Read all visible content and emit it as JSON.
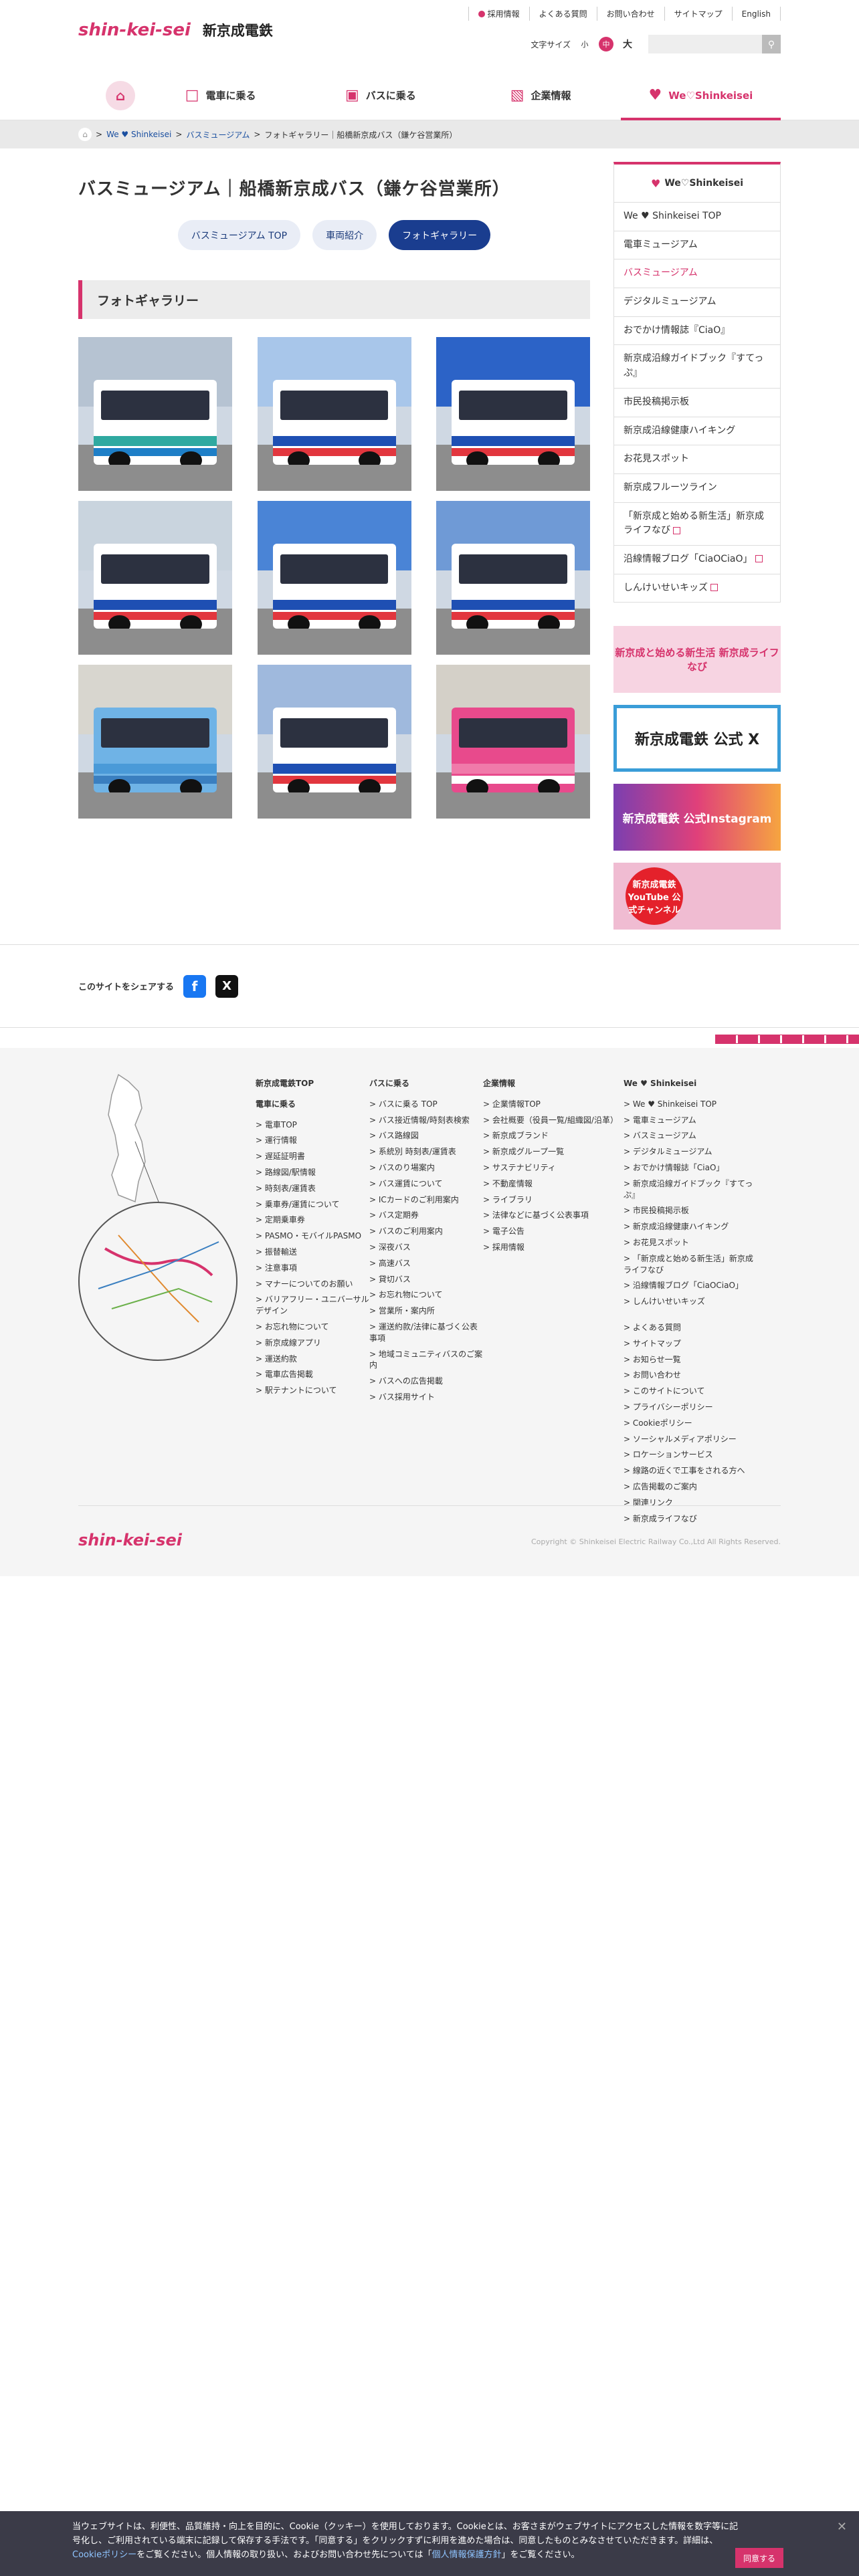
{
  "header": {
    "logo_mark": "shin-kei-sei",
    "logo_name": "新京成電鉄",
    "util_links": [
      "採用情報",
      "よくある質問",
      "お問い合わせ",
      "サイトマップ",
      "English"
    ],
    "font_size_label": "文字サイズ",
    "font_sizes": [
      "小",
      "中",
      "大"
    ],
    "search_placeholder": ""
  },
  "gnav": {
    "items": [
      {
        "label": "電車に乗る",
        "icon": "train-icon"
      },
      {
        "label": "バスに乗る",
        "icon": "bus-icon"
      },
      {
        "label": "企業情報",
        "icon": "building-icon"
      },
      {
        "label": "We♡Shinkeisei",
        "icon": "heart-icon"
      }
    ]
  },
  "breadcrumb": [
    "We ♥ Shinkeisei",
    "バスミュージアム",
    "フォトギャラリー｜船橋新京成バス（鎌ケ谷営業所）"
  ],
  "page": {
    "title": "バスミュージアム｜船橋新京成バス（鎌ケ谷営業所）",
    "tabs": [
      "バスミュージアム TOP",
      "車両紹介",
      "フォトギャラリー"
    ],
    "section_title": "フォトギャラリー",
    "photos": [
      {
        "body": "#ffffff",
        "stripe": "#2fa9a0",
        "stripe2": "#1e7fc7",
        "sky": "#b6c3d2"
      },
      {
        "body": "#ffffff",
        "stripe": "#1e4fb3",
        "stripe2": "#e2363e",
        "sky": "#a8c6ea"
      },
      {
        "body": "#ffffff",
        "stripe": "#1e4fb3",
        "stripe2": "#e2363e",
        "sky": "#2c63c7"
      },
      {
        "body": "#ffffff",
        "stripe": "#1e4fb3",
        "stripe2": "#e2363e",
        "sky": "#c9d4de"
      },
      {
        "body": "#ffffff",
        "stripe": "#1e4fb3",
        "stripe2": "#e2363e",
        "sky": "#4a84d6"
      },
      {
        "body": "#ffffff",
        "stripe": "#1e4fb3",
        "stripe2": "#e2363e",
        "sky": "#6f9ad6"
      },
      {
        "body": "#6fb3e6",
        "stripe": "#4a9ad8",
        "stripe2": "#3a7fc0",
        "sky": "#d8d6cf"
      },
      {
        "body": "#ffffff",
        "stripe": "#1e4fb3",
        "stripe2": "#e2363e",
        "sky": "#9fb9dd"
      },
      {
        "body": "#e84a8c",
        "stripe": "#f07aaa",
        "stripe2": "#ffffff",
        "sky": "#d4d0c8"
      }
    ]
  },
  "sidebar": {
    "title": "We♡Shinkeisei",
    "items": [
      {
        "label": "We ♥ Shinkeisei TOP",
        "ext": false
      },
      {
        "label": "電車ミュージアム",
        "ext": false
      },
      {
        "label": "バスミュージアム",
        "ext": false,
        "current": true
      },
      {
        "label": "デジタルミュージアム",
        "ext": false
      },
      {
        "label": "おでかけ情報誌『CiaO』",
        "ext": false
      },
      {
        "label": "新京成沿線ガイドブック『すてっぷ』",
        "ext": false
      },
      {
        "label": "市民投稿掲示板",
        "ext": false
      },
      {
        "label": "新京成沿線健康ハイキング",
        "ext": false
      },
      {
        "label": "お花見スポット",
        "ext": false
      },
      {
        "label": "新京成フルーツライン",
        "ext": false
      },
      {
        "label": "「新京成と始める新生活」新京成ライフなび",
        "ext": true
      },
      {
        "label": "沿線情報ブログ「CiaOCiaO」",
        "ext": true
      },
      {
        "label": "しんけいせいキッズ",
        "ext": true
      }
    ],
    "banners": [
      "新京成と始める新生活 新京成ライフなび",
      "新京成電鉄 公式 X",
      "新京成電鉄 公式Instagram",
      "新京成電鉄 YouTube 公式チャンネル"
    ]
  },
  "share": {
    "label": "このサイトをシェアする"
  },
  "footer": {
    "col1": {
      "title": "新京成電鉄TOP",
      "subtitle": "電車に乗る",
      "items": [
        "電車TOP",
        "運行情報",
        "遅延証明書",
        "路線図/駅情報",
        "時刻表/運賃表",
        "乗車券/運賃について",
        "定期乗車券",
        "PASMO・モバイルPASMO",
        "振替輸送",
        "注意事項",
        "マナーについてのお願い",
        "バリアフリー・ユニバーサルデザイン",
        "お忘れ物について",
        "新京成線アプリ",
        "運送約款",
        "電車広告掲載",
        "駅テナントについて"
      ]
    },
    "col2": {
      "title": "バスに乗る",
      "items": [
        "バスに乗る TOP",
        "バス接近情報/時刻表検索",
        "バス路線図",
        "系統別 時刻表/運賃表",
        "バスのり場案内",
        "バス運賃について",
        "ICカードのご利用案内",
        "バス定期券",
        "バスのご利用案内",
        "深夜バス",
        "高速バス",
        "貸切バス",
        "お忘れ物について",
        "営業所・案内所",
        "運送約款/法律に基づく公表事項",
        "地域コミュニティバスのご案内",
        "バスへの広告掲載",
        "バス採用サイト"
      ]
    },
    "col3": {
      "title": "企業情報",
      "items": [
        "企業情報TOP",
        "会社概要（役員一覧/組織図/沿革）",
        "新京成ブランド",
        "新京成グループ一覧",
        "サステナビリティ",
        "不動産情報",
        "ライブラリ",
        "法律などに基づく公表事項",
        "電子公告",
        "採用情報"
      ]
    },
    "col4": {
      "title": "We ♥ Shinkeisei",
      "items": [
        "We ♥ Shinkeisei TOP",
        "電車ミュージアム",
        "バスミュージアム",
        "デジタルミュージアム",
        "おでかけ情報誌「CiaO」",
        "新京成沿線ガイドブック『すてっぷ』",
        "市民投稿掲示板",
        "新京成沿線健康ハイキング",
        "お花見スポット",
        "「新京成と始める新生活」新京成ライフなび",
        "沿線情報ブログ「CiaOCiaO」",
        "しんけいせいキッズ"
      ],
      "items2": [
        "よくある質問",
        "サイトマップ",
        "お知らせ一覧",
        "お問い合わせ",
        "このサイトについて",
        "プライバシーポリシー",
        "Cookieポリシー",
        "ソーシャルメディアポリシー",
        "ロケーションサービス",
        "線路の近くで工事をされる方へ",
        "広告掲載のご案内",
        "関連リンク",
        "新京成ライフなび"
      ]
    },
    "logo": "shin-kei-sei",
    "copyright": "Copyright © Shinkeisei Electric Railway Co.,Ltd All Rights Reserved."
  },
  "cookie": {
    "text": "当ウェブサイトは、利便性、品質維持・向上を目的に、Cookie（クッキー）を使用しております。Cookieとは、お客さまがウェブサイトにアクセスした情報を数字等に記号化し、ご利用されている端末に記録して保存する手法です。「同意する」をクリックすずに利用を進めた場合は、同意したものとみなさせていただきます。詳細は、",
    "link1": "Cookieポリシー",
    "mid": "をご覧ください。個人情報の取り扱い、およびお問い合わせ先については「",
    "link2": "個人情報保護方針",
    "end": "」をご覧ください。",
    "accept": "同意する"
  },
  "colors": {
    "accent": "#d6336c",
    "navy": "#1a3d8f"
  }
}
